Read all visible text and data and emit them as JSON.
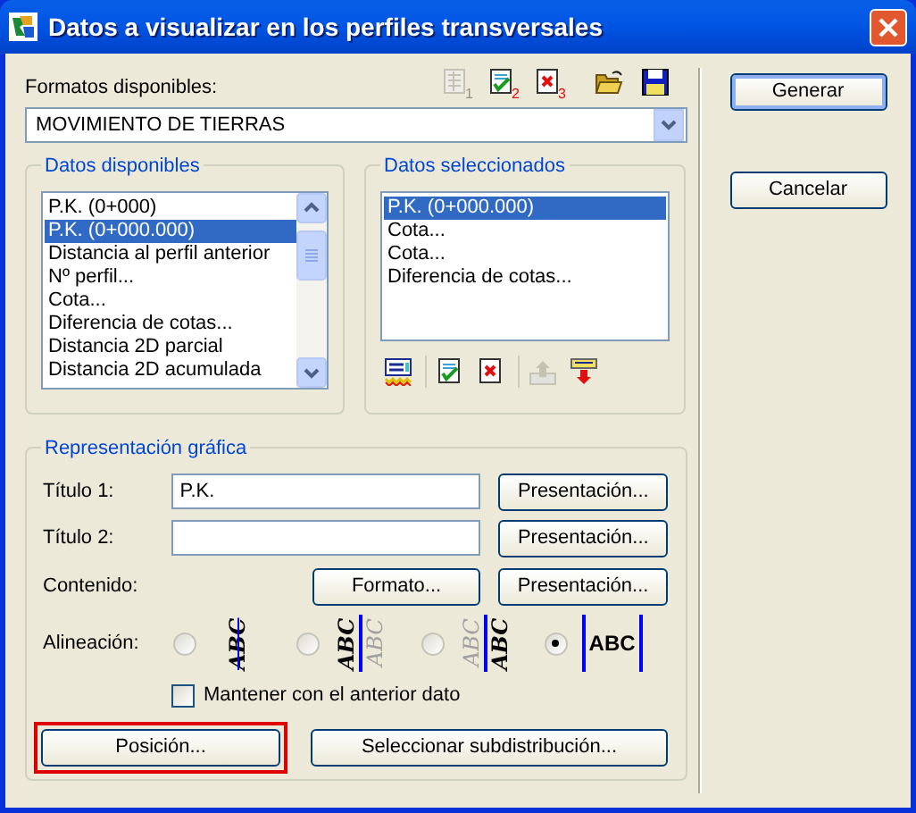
{
  "window": {
    "title": "Datos a visualizar en los perfiles transversales"
  },
  "formats": {
    "label": "Formatos disponibles:",
    "value": "MOVIMIENTO DE TIERRAS"
  },
  "format_toolbar": [
    {
      "kind": "grid",
      "disabled": true,
      "badge": "1"
    },
    {
      "kind": "check",
      "disabled": false,
      "badge": "2"
    },
    {
      "kind": "cross",
      "disabled": false,
      "badge": "3"
    },
    {
      "kind": "folder",
      "disabled": false
    },
    {
      "kind": "save",
      "disabled": false
    }
  ],
  "side_buttons": [
    {
      "label": "Generar",
      "default": true
    },
    {
      "label": "Cancelar",
      "default": false
    }
  ],
  "available": {
    "title": "Datos disponibles",
    "items": [
      {
        "text": "P.K. (0+000)",
        "selected": false
      },
      {
        "text": "P.K. (0+000.000)",
        "selected": true
      },
      {
        "text": "Distancia al perfil anterior",
        "selected": false
      },
      {
        "text": "Nº perfil...",
        "selected": false
      },
      {
        "text": "Cota...",
        "selected": false
      },
      {
        "text": "Diferencia de cotas...",
        "selected": false
      },
      {
        "text": "Distancia 2D parcial",
        "selected": false
      },
      {
        "text": "Distancia 2D acumulada",
        "selected": false
      }
    ]
  },
  "chosen": {
    "title": "Datos seleccionados",
    "items": [
      {
        "text": "P.K. (0+000.000)",
        "selected": true
      },
      {
        "text": "Cota...",
        "selected": false
      },
      {
        "text": "Cota...",
        "selected": false
      },
      {
        "text": "Diferencia de cotas...",
        "selected": false
      }
    ],
    "toolbar": [
      {
        "kind": "add",
        "disabled": false
      },
      {
        "kind": "check",
        "disabled": false
      },
      {
        "kind": "cross",
        "disabled": false
      },
      {
        "kind": "up",
        "disabled": true
      },
      {
        "kind": "down",
        "disabled": false
      }
    ]
  },
  "representation": {
    "title": "Representación gráfica",
    "title1": {
      "label": "Título 1:",
      "value": "P.K.",
      "button": "Presentación..."
    },
    "title2": {
      "label": "Título 2:",
      "button": "Presentación..."
    },
    "content": {
      "label": "Contenido:",
      "format_button": "Formato...",
      "button": "Presentación..."
    },
    "alignment": {
      "label": "Alineación:",
      "options": [
        {
          "kind": "center",
          "selected": false,
          "samples": [
            {
              "text": "ABC",
              "dim": false
            }
          ]
        },
        {
          "kind": "left",
          "selected": false,
          "samples": [
            {
              "text": "ABC",
              "dim": false
            },
            {
              "text": "ABC",
              "dim": true
            }
          ]
        },
        {
          "kind": "right",
          "selected": false,
          "samples": [
            {
              "text": "ABC",
              "dim": true
            },
            {
              "text": "ABC",
              "dim": false
            }
          ]
        },
        {
          "kind": "horizontal",
          "selected": true,
          "samples": [
            {
              "text": "ABC",
              "dim": false
            }
          ]
        }
      ]
    },
    "keep": {
      "label": "Mantener con el anterior dato",
      "checked": false
    },
    "position_button": {
      "label": "Posición...",
      "highlighted": true
    },
    "subdistribution_button": {
      "label": "Seleccionar subdistribución..."
    }
  }
}
